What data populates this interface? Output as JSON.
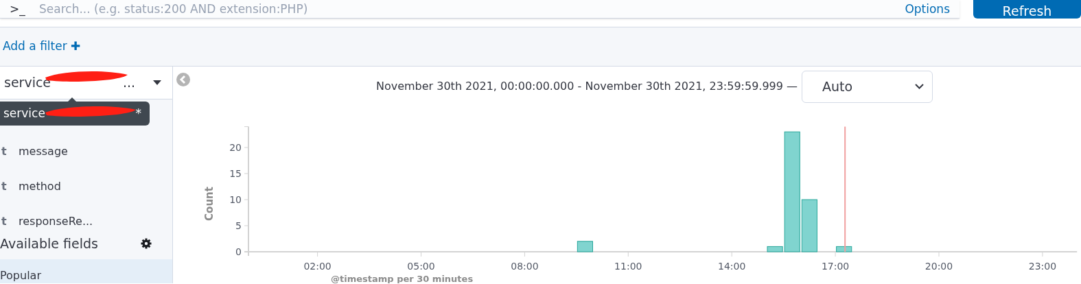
{
  "query_bar": {
    "prompt": ">_",
    "placeholder": "Search... (e.g. status:200 AND extension:PHP)",
    "options": "Options",
    "refresh": "Refresh"
  },
  "filter_bar": {
    "add_filter": "Add a filter",
    "plus": "✚"
  },
  "sidebar": {
    "index_pattern": {
      "label": "service",
      "ellipsis": "...",
      "redacted": true
    },
    "tooltip": {
      "label": "service",
      "suffix": "*",
      "redacted": true
    },
    "selected_fields": [
      {
        "type": "t",
        "name": "message"
      },
      {
        "type": "t",
        "name": "method"
      },
      {
        "type": "t",
        "name": "responseRe..."
      }
    ],
    "available_heading": "Available fields",
    "popular": "Popular"
  },
  "histogram": {
    "time_range": "November 30th 2021, 00:00:00.000 - November 30th 2021, 23:59:59.999 —",
    "interval": "Auto",
    "chart_data": {
      "type": "bar",
      "xlabel": "@timestamp per 30 minutes",
      "ylabel": "Count",
      "x": [
        9.75,
        15.25,
        15.75,
        16.25,
        17.25
      ],
      "values": [
        2,
        1,
        23,
        10,
        1
      ],
      "xlim": [
        0,
        24
      ],
      "ylim": [
        0,
        24
      ],
      "xticks": [
        {
          "value": 2,
          "label": "02:00"
        },
        {
          "value": 5,
          "label": "05:00"
        },
        {
          "value": 8,
          "label": "08:00"
        },
        {
          "value": 11,
          "label": "11:00"
        },
        {
          "value": 14,
          "label": "14:00"
        },
        {
          "value": 17,
          "label": "17:00"
        },
        {
          "value": 20,
          "label": "20:00"
        },
        {
          "value": 23,
          "label": "23:00"
        }
      ],
      "yticks": [
        0,
        5,
        10,
        15,
        20
      ],
      "ref_lines": [
        {
          "axis": "x",
          "value": 17.28
        }
      ]
    }
  }
}
